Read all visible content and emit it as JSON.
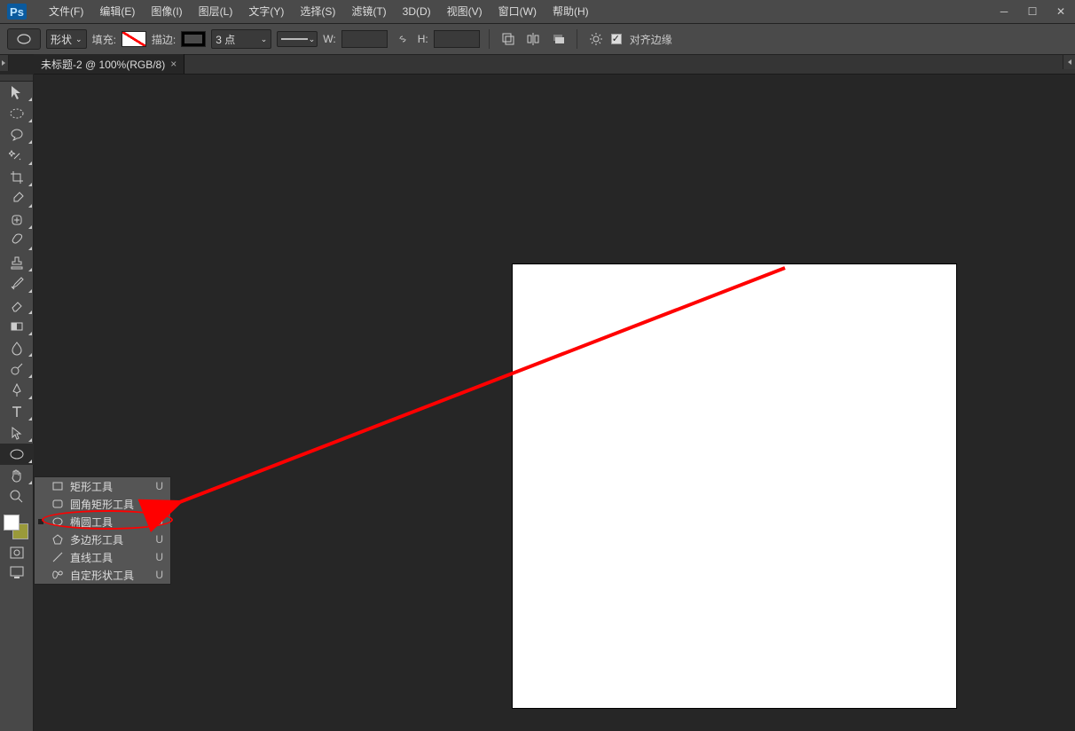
{
  "menubar": {
    "logo": "Ps",
    "items": [
      "文件(F)",
      "编辑(E)",
      "图像(I)",
      "图层(L)",
      "文字(Y)",
      "选择(S)",
      "滤镜(T)",
      "3D(D)",
      "视图(V)",
      "窗口(W)",
      "帮助(H)"
    ]
  },
  "optbar": {
    "mode_label": "形状",
    "fill_label": "填充:",
    "stroke_label": "描边:",
    "stroke_width": "3 点",
    "w_label": "W:",
    "h_label": "H:",
    "align_label": "对齐边缘"
  },
  "tab": {
    "title": "未标题-2 @ 100%(RGB/8)"
  },
  "flyout": {
    "items": [
      {
        "label": "矩形工具",
        "key": "U",
        "shape": "rect"
      },
      {
        "label": "圆角矩形工具",
        "key": "U",
        "shape": "roundrect"
      },
      {
        "label": "椭圆工具",
        "key": "U",
        "shape": "ellipse",
        "active": true
      },
      {
        "label": "多边形工具",
        "key": "U",
        "shape": "poly"
      },
      {
        "label": "直线工具",
        "key": "U",
        "shape": "line"
      },
      {
        "label": "自定形状工具",
        "key": "U",
        "shape": "custom"
      }
    ]
  }
}
